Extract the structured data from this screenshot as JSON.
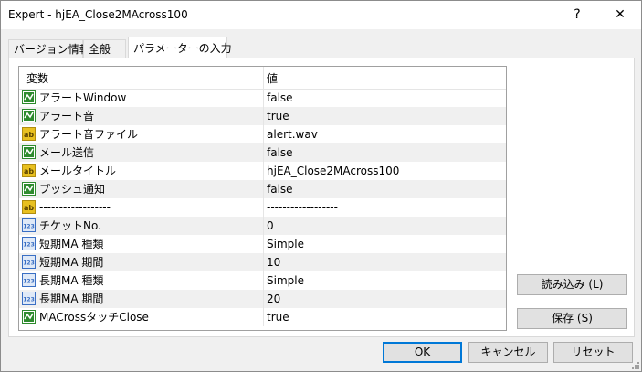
{
  "window": {
    "title": "Expert - hjEA_Close2MAcross100",
    "help": "?",
    "close": "✕"
  },
  "tabs": [
    {
      "label": "バージョン情報"
    },
    {
      "label": "全般"
    },
    {
      "label": "パラメーターの入力"
    }
  ],
  "grid": {
    "col_name": "変数",
    "col_value": "値",
    "rows": [
      {
        "icon": "bool",
        "name": "アラートWindow",
        "value": "false"
      },
      {
        "icon": "bool",
        "name": "アラート音",
        "value": "true"
      },
      {
        "icon": "text",
        "name": "アラート音ファイル",
        "value": "alert.wav"
      },
      {
        "icon": "bool",
        "name": "メール送信",
        "value": "false"
      },
      {
        "icon": "text",
        "name": "メールタイトル",
        "value": "hjEA_Close2MAcross100"
      },
      {
        "icon": "bool",
        "name": "プッシュ通知",
        "value": "false"
      },
      {
        "icon": "text",
        "name": "------------------",
        "value": "------------------"
      },
      {
        "icon": "int",
        "name": "チケットNo.",
        "value": "0"
      },
      {
        "icon": "int",
        "name": "短期MA 種類",
        "value": "Simple"
      },
      {
        "icon": "int",
        "name": "短期MA 期間",
        "value": "10"
      },
      {
        "icon": "int",
        "name": "長期MA 種類",
        "value": "Simple"
      },
      {
        "icon": "int",
        "name": "長期MA 期間",
        "value": "20"
      },
      {
        "icon": "bool",
        "name": "MACrossタッチClose",
        "value": "true"
      }
    ]
  },
  "buttons": {
    "load": "読み込み (L)",
    "save": "保存 (S)",
    "ok": "OK",
    "cancel": "キャンセル",
    "reset": "リセット"
  },
  "icon_labels": {
    "text": "ab",
    "int": "123"
  },
  "colors": {
    "bool_icon_bg": "#2e8b2e",
    "text_icon_bg": "#e8c020",
    "int_icon_bg": "#3a6fc4",
    "ok_border": "#0078d7"
  }
}
